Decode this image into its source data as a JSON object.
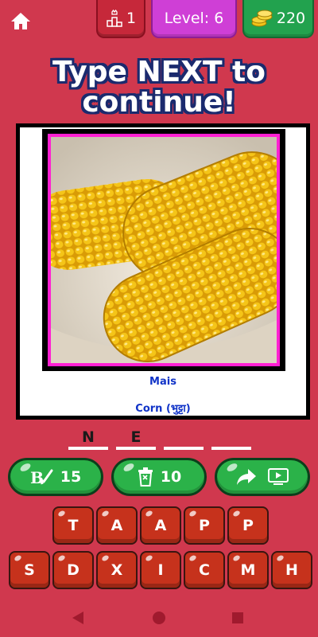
{
  "topbar": {
    "rank_value": "1",
    "level_label": "Level: 6",
    "coins_value": "220"
  },
  "headline": {
    "line1": "Type NEXT to",
    "line2": "continue!"
  },
  "card": {
    "caption_main": "Mais",
    "caption_translation": "Corn (भुट्टा)"
  },
  "answer_slots": [
    "N",
    "E",
    "",
    ""
  ],
  "actions": {
    "hint_count": "15",
    "remove_count": "10"
  },
  "tiles_row1": [
    "T",
    "A",
    "A",
    "P",
    "P"
  ],
  "tiles_row2": [
    "S",
    "D",
    "X",
    "I",
    "C",
    "M",
    "H"
  ],
  "colors": {
    "background": "#d0384e",
    "level_pill": "#cf3fd6",
    "coins_pill": "#22a24e",
    "action_button": "#2bb249",
    "tile": "#c6321c",
    "headline_outline": "#1b2a6e",
    "photo_border": "#ff1fd2"
  },
  "icons": {
    "home": "home-icon",
    "rank": "podium-icon",
    "coins": "coins-icon",
    "hint": "paint-brush-icon",
    "remove": "trash-icon",
    "share": "share-arrow-icon",
    "video": "video-play-icon",
    "nav": [
      "back-icon",
      "home-circle-icon",
      "recents-icon"
    ]
  }
}
